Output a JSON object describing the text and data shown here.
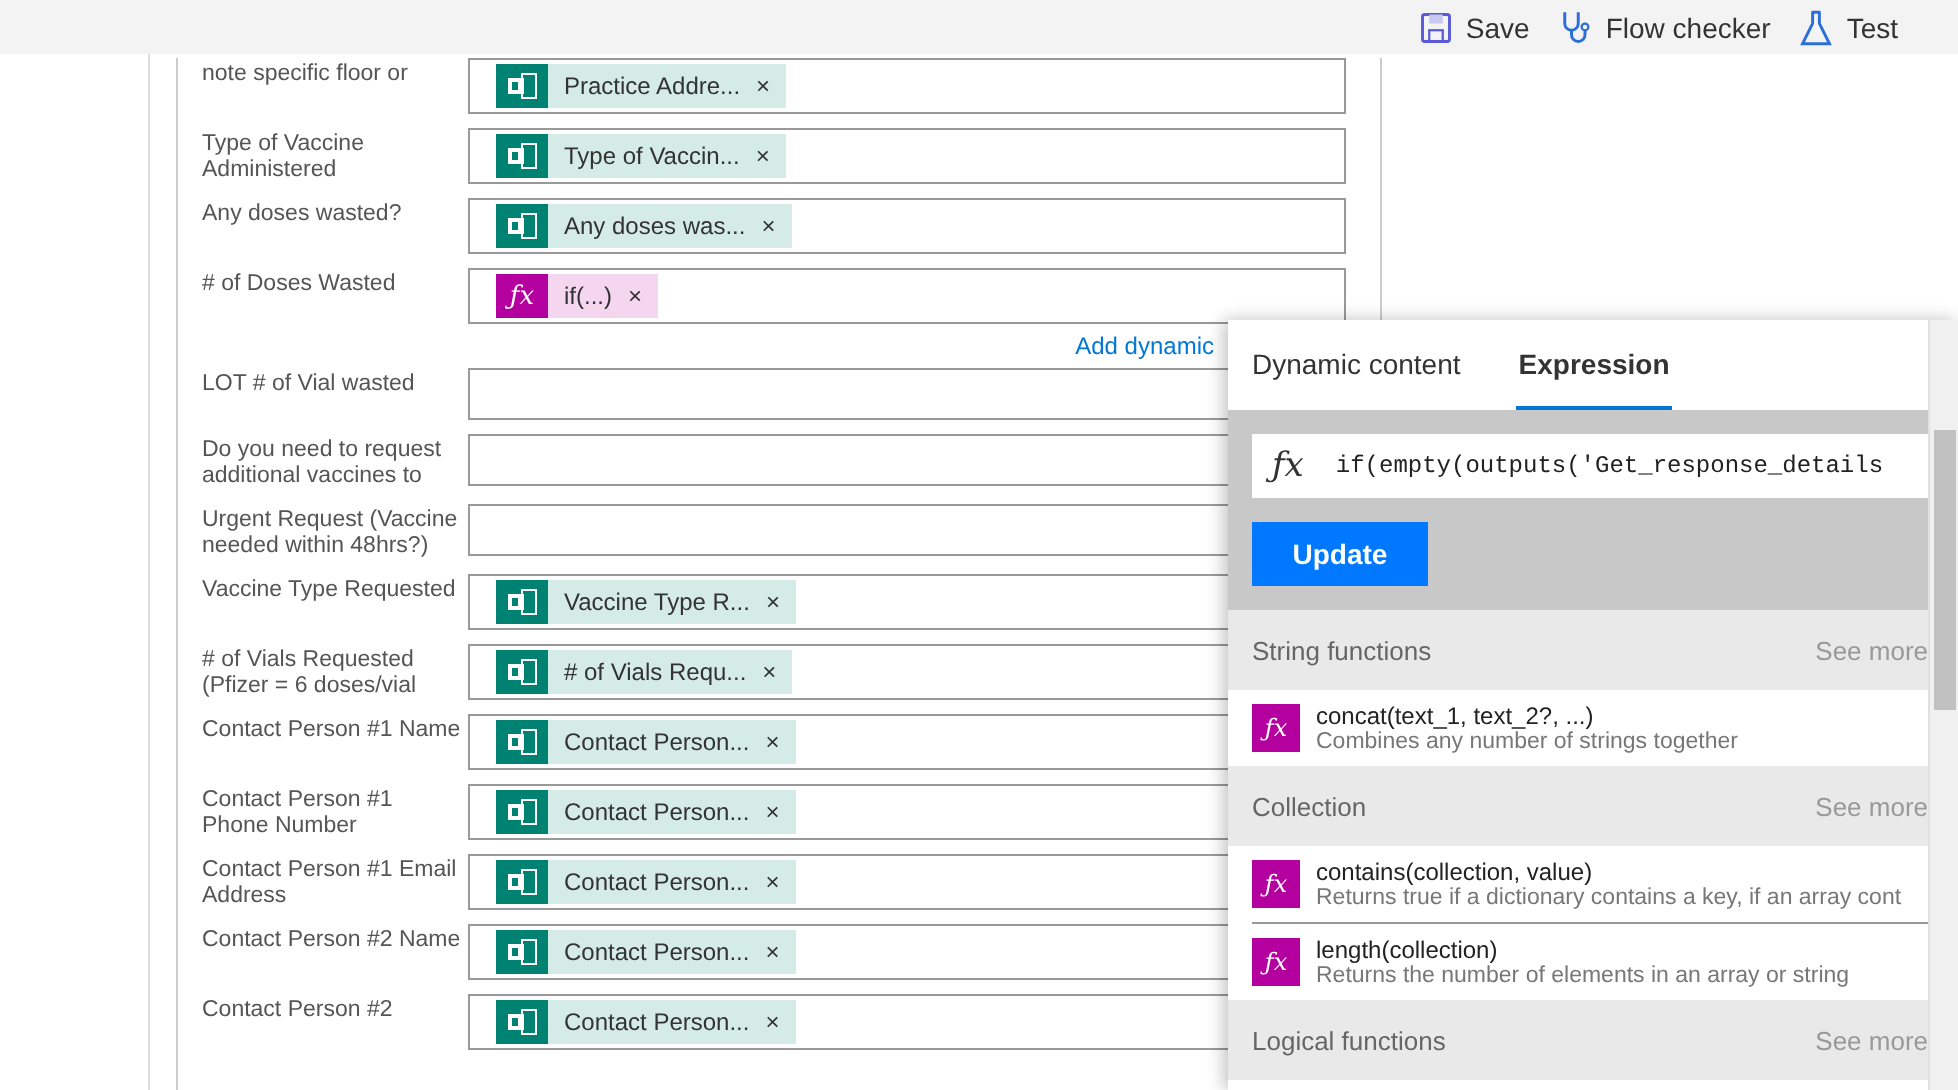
{
  "toolbar": [
    {
      "kind": "save",
      "label": "Save"
    },
    {
      "kind": "checker",
      "label": "Flow checker"
    },
    {
      "kind": "test",
      "label": "Test"
    }
  ],
  "form": {
    "rows": [
      {
        "label": "note specific floor or",
        "token": {
          "kind": "forms",
          "text": "Practice Addre...",
          "remove": "×"
        }
      },
      {
        "label": "Type of Vaccine Administered",
        "token": {
          "kind": "forms",
          "text": "Type of Vaccin...",
          "remove": "×"
        }
      },
      {
        "label": "Any doses wasted?",
        "token": {
          "kind": "forms",
          "text": "Any doses was...",
          "remove": "×"
        }
      },
      {
        "label": "# of Doses Wasted",
        "token": {
          "kind": "expression",
          "icon": "ƒx",
          "text": "if(...)",
          "remove": "×"
        }
      },
      {
        "kind": "link",
        "text": "Add dynamic"
      },
      {
        "label": "LOT # of Vial wasted"
      },
      {
        "label": "Do you need to request additional vaccines to"
      },
      {
        "label": "Urgent Request (Vaccine needed within 48hrs?)"
      },
      {
        "label": "Vaccine Type Requested",
        "token": {
          "kind": "forms",
          "text": "Vaccine Type R...",
          "remove": "×"
        }
      },
      {
        "label": "# of Vials Requested (Pfizer = 6 doses/vial",
        "token": {
          "kind": "forms",
          "text": "# of Vials Requ...",
          "remove": "×"
        }
      },
      {
        "label": "Contact Person #1 Name",
        "token": {
          "kind": "forms",
          "text": "Contact Person...",
          "remove": "×"
        }
      },
      {
        "label": "Contact Person #1 Phone Number",
        "token": {
          "kind": "forms",
          "text": "Contact Person...",
          "remove": "×"
        }
      },
      {
        "label": "Contact Person #1 Email Address",
        "token": {
          "kind": "forms",
          "text": "Contact Person...",
          "remove": "×"
        }
      },
      {
        "label": "Contact Person #2 Name",
        "token": {
          "kind": "forms",
          "text": "Contact Person...",
          "remove": "×"
        }
      },
      {
        "label": "Contact Person #2",
        "token": {
          "kind": "forms",
          "text": "Contact Person...",
          "remove": "×"
        }
      }
    ]
  },
  "expression_panel": {
    "tabs": [
      {
        "label": "Dynamic content",
        "selected": false
      },
      {
        "label": "Expression",
        "selected": true
      }
    ],
    "expression_icon": "ƒx",
    "expression": "if(empty(outputs('Get_response_details",
    "update_button": "Update",
    "sections": [
      {
        "title": "String functions",
        "see_more": "See more",
        "functions": [
          {
            "icon": "ƒx",
            "name": "concat(text_1, text_2?, ...)",
            "description": "Combines any number of strings together"
          }
        ]
      },
      {
        "title": "Collection",
        "see_more": "See more",
        "functions": [
          {
            "icon": "ƒx",
            "name": "contains(collection, value)",
            "description": "Returns true if a dictionary contains a key, if an array cont"
          },
          {
            "icon": "ƒx",
            "name": "length(collection)",
            "description": "Returns the number of elements in an array or string"
          }
        ]
      },
      {
        "title": "Logical functions",
        "see_more": "See more"
      }
    ]
  }
}
